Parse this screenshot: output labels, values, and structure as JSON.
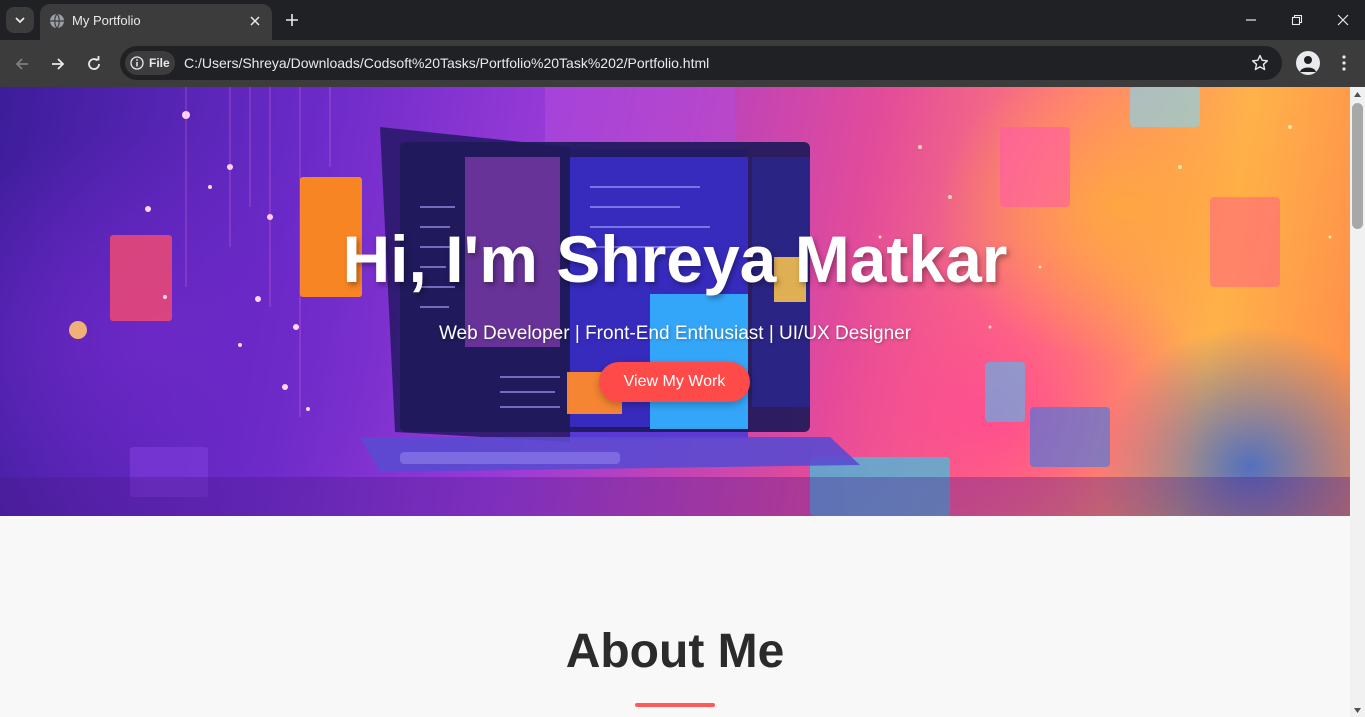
{
  "browser": {
    "tab_title": "My Portfolio",
    "url_chip": "File",
    "url": "C:/Users/Shreya/Downloads/Codsoft%20Tasks/Portfolio%20Task%202/Portfolio.html",
    "icons": [
      "tab-search-icon",
      "globe-icon",
      "close-icon",
      "plus-icon",
      "minimize-icon",
      "restore-icon",
      "back-icon",
      "forward-icon",
      "reload-icon",
      "info-icon",
      "star-icon",
      "profile-icon",
      "kebab-menu-icon"
    ]
  },
  "hero": {
    "title": "Hi, I'm Shreya Matkar",
    "subtitle": "Web Developer | Front-End Enthusiast | UI/UX Designer",
    "cta_label": "View My Work",
    "cta_color": "#ff4a4a"
  },
  "about": {
    "title": "About Me",
    "accent_color": "#ff5a5a"
  }
}
